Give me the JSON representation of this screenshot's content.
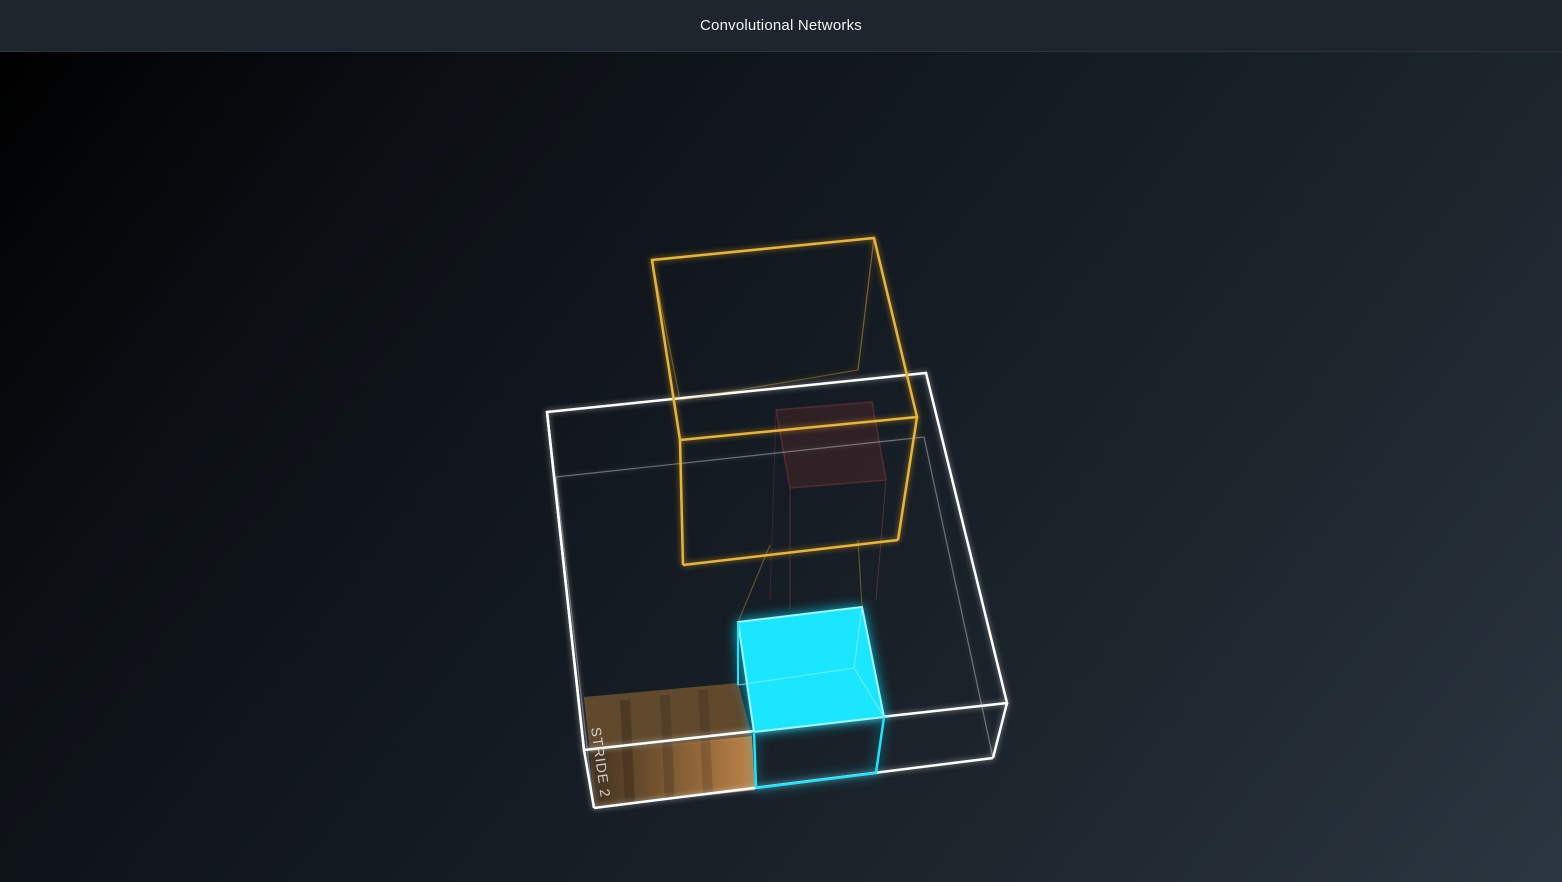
{
  "header": {
    "title": "Convolutional Networks"
  },
  "scene": {
    "stride_label": "STRIDE 2",
    "colors": {
      "input_volume": "#ffffff",
      "filter_volume": "#e8b43a",
      "receptive_field": "#19e3ff",
      "strided_region": "#c8894a",
      "output_cell": "#7a2f2f",
      "header_bg": "#1e252c"
    }
  }
}
